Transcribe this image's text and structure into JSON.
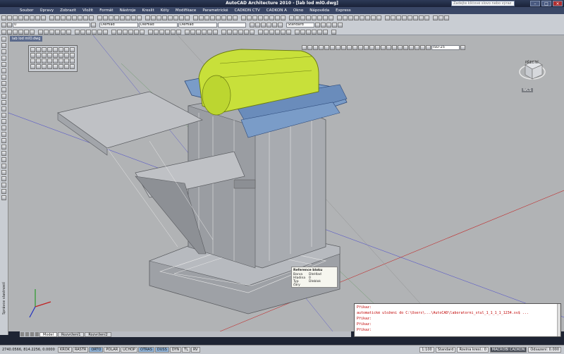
{
  "window": {
    "title": "AutoCAD Architecture 2010 - [lab lod mlO.dwg]",
    "search_placeholder": "Zadejte klíčové slovo nebo výraz",
    "file_tab": "lab lod mlO.dwg"
  },
  "menu": [
    "Soubor",
    "Úpravy",
    "Zobrazit",
    "Vložit",
    "Formát",
    "Nástroje",
    "Kreslit",
    "Kóty",
    "Modifikace",
    "Parametrické",
    "CADKON CTV",
    "CADKON A",
    "Okno",
    "Nápověda",
    "Express"
  ],
  "toolbars": {
    "layer_combo": "0",
    "color_combo": "DleHlad",
    "linetype_combo": "DleHlad",
    "lineweight_combo": "DleHlad",
    "style_combo": "Standard",
    "scale_combo": "ISO-25"
  },
  "left_palette_label": "Správce vlastností",
  "viewcube": {
    "label": "PŘEDNÍ",
    "ucs": "WCS"
  },
  "tooltip": {
    "title": "Reference bloku",
    "rows": [
      {
        "key": "Barva",
        "value": "DleHlad"
      },
      {
        "key": "Hladina",
        "value": "0"
      },
      {
        "key": "Typ čáry",
        "value": "Dleblok"
      }
    ]
  },
  "command_window": {
    "lines": [
      "Příkaz:",
      "automatické uložení do C:\\Users\\...\\AutoCAD\\laboratorni_stul_1_1_1_1_1234.sv$ ...",
      "Příkaz:",
      "Příkaz:",
      "Příkaz:"
    ]
  },
  "layout_tabs": [
    "Model",
    "Rozvržení1",
    "Rozvržení2"
  ],
  "status": {
    "coords": "2740.0566, 814.2256, 0.0000",
    "toggles": [
      {
        "label": "KROK",
        "on": false
      },
      {
        "label": "RASTR",
        "on": false
      },
      {
        "label": "ORTO",
        "on": true
      },
      {
        "label": "POLAR",
        "on": false
      },
      {
        "label": "UCHOP",
        "on": false
      },
      {
        "label": "OTRAS",
        "on": true
      },
      {
        "label": "DUSS",
        "on": true
      },
      {
        "label": "DYN",
        "on": false
      },
      {
        "label": "TL",
        "on": false
      },
      {
        "label": "RV",
        "on": false
      }
    ],
    "scale": "1:100",
    "style": "Standard",
    "elevation": "Rovina kresl.: 0",
    "app_label": "MACROBI CADKON",
    "detail": "Odsazení: 0.000"
  },
  "colors": {
    "viewport_bg": "#b1b3b5",
    "lime_selected": "#c8e03a",
    "blue_part": "#7a9cc8",
    "command_text": "#c00000"
  }
}
